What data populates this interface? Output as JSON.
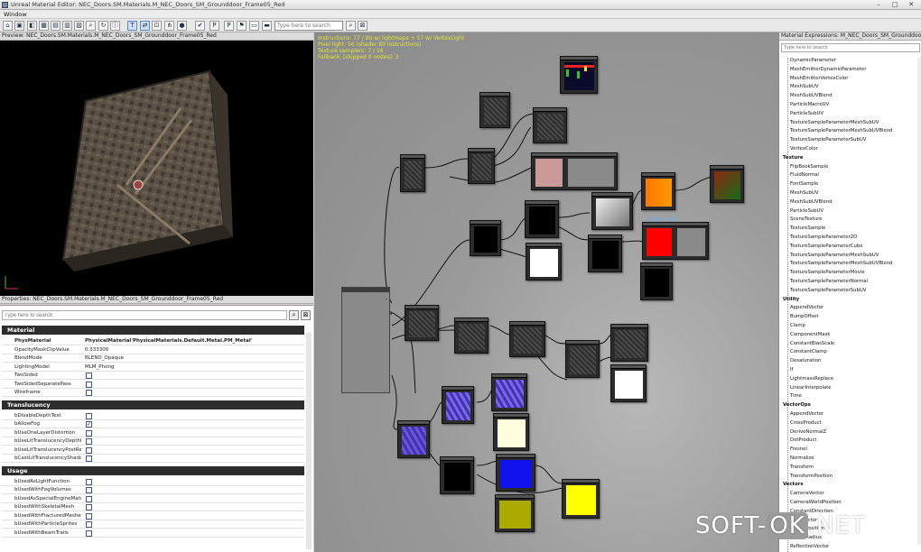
{
  "window": {
    "title": "Unreal Material Editor: NEC_Doors.SM.Materials.M_NEC_Doors_SM_Grounddoor_Frame05_Red",
    "menu": "Window"
  },
  "toolbar": {
    "search_placeholder": "Type here to search"
  },
  "preview": {
    "title": "Preview: NEC_Doors.SM.Materials.M_NEC_Doors_SM_Grounddoor_Frame05_Red"
  },
  "properties": {
    "title": "Properties: NEC_Doors.SM.Materials.M_NEC_Doors_SM_Grounddoor_Frame05_Red",
    "search_placeholder": "Type here to search",
    "sections": [
      {
        "name": "Material",
        "rows": [
          {
            "key": "PhysMaterial",
            "value": "PhysicalMaterial'PhysicalMaterials.Default.Metal.PM_Metal'",
            "bold": true
          },
          {
            "key": "OpacityMaskClipValue",
            "value": "0.333300"
          },
          {
            "key": "BlendMode",
            "value": "BLEND_Opaque"
          },
          {
            "key": "LightingModel",
            "value": "MLM_Phong"
          },
          {
            "key": "TwoSided",
            "checked": false
          },
          {
            "key": "TwoSidedSeparatePass",
            "checked": false
          },
          {
            "key": "Wireframe",
            "checked": false
          }
        ]
      },
      {
        "name": "Translucency",
        "rows": [
          {
            "key": "bDisableDepthTest",
            "checked": false
          },
          {
            "key": "bAllowFog",
            "checked": true
          },
          {
            "key": "bUseOneLayerDistortion",
            "checked": false
          },
          {
            "key": "bUseLitTranslucencyDepthPa",
            "checked": false
          },
          {
            "key": "bUseLitTranslucencyPostRen",
            "checked": false
          },
          {
            "key": "bCastLitTranslucencyShadow",
            "checked": false
          }
        ]
      },
      {
        "name": "Usage",
        "rows": [
          {
            "key": "bUsedAsLightFunction",
            "checked": false
          },
          {
            "key": "bUsedWithFogVolumes",
            "checked": false
          },
          {
            "key": "bUsedAsSpecialEngineMateri",
            "checked": false
          },
          {
            "key": "bUsedWithSkeletalMesh",
            "checked": false
          },
          {
            "key": "bUsedWithFracturedMeshes",
            "checked": false
          },
          {
            "key": "bUsedWithParticleSprites",
            "checked": false
          },
          {
            "key": "bUsedWithBeamTrails",
            "checked": false
          }
        ]
      }
    ]
  },
  "graph": {
    "stats": "Instructions: 77 / 80 w/ lightmaps + 57 w/ VertexLight\nPixel light: 56 (shader 80 instructions)\nTexture samplers: 7 / 16\nFallback: [skipped 0 nodes]: 3",
    "light_color_label": "Light Color"
  },
  "expressions": {
    "title": "Material Expressions: M_NEC_Doors_SM_Grounddoor_Frame05_Red",
    "search_placeholder": "Type here to search",
    "items": [
      {
        "label": "DynamicParameter"
      },
      {
        "label": "MeshEmitterDynamicParameter"
      },
      {
        "label": "MeshEmitterVertexColor"
      },
      {
        "label": "MeshSubUV"
      },
      {
        "label": "MeshSubUVBlend"
      },
      {
        "label": "ParticleMacroUV"
      },
      {
        "label": "ParticleSubUV"
      },
      {
        "label": "TextureSampleParameterMeshSubUV"
      },
      {
        "label": "TextureSampleParameterMeshSubUVBlend"
      },
      {
        "label": "TextureSampleParameterSubUV"
      },
      {
        "label": "VertexColor"
      },
      {
        "label": "Texture",
        "cat": true
      },
      {
        "label": "FlipBookSample"
      },
      {
        "label": "FluidNormal"
      },
      {
        "label": "FontSample"
      },
      {
        "label": "MeshSubUV"
      },
      {
        "label": "MeshSubUVBlend"
      },
      {
        "label": "ParticleSubUV"
      },
      {
        "label": "SceneTexture"
      },
      {
        "label": "TextureSample"
      },
      {
        "label": "TextureSampleParameter2D"
      },
      {
        "label": "TextureSampleParameterCube"
      },
      {
        "label": "TextureSampleParameterMeshSubUV"
      },
      {
        "label": "TextureSampleParameterMeshSubUVBlend"
      },
      {
        "label": "TextureSampleParameterMovie"
      },
      {
        "label": "TextureSampleParameterNormal"
      },
      {
        "label": "TextureSampleParameterSubUV"
      },
      {
        "label": "Utility",
        "cat": true
      },
      {
        "label": "AppendVector"
      },
      {
        "label": "BumpOffset"
      },
      {
        "label": "Clamp"
      },
      {
        "label": "ComponentMask"
      },
      {
        "label": "ConstantBiasScale"
      },
      {
        "label": "ConstantClamp"
      },
      {
        "label": "Desaturation"
      },
      {
        "label": "If"
      },
      {
        "label": "LightmassReplace"
      },
      {
        "label": "LinearInterpolate"
      },
      {
        "label": "Time"
      },
      {
        "label": "VectorOps",
        "cat": true
      },
      {
        "label": "AppendVector"
      },
      {
        "label": "CrossProduct"
      },
      {
        "label": "DeriveNormalZ"
      },
      {
        "label": "DotProduct"
      },
      {
        "label": "Fresnel"
      },
      {
        "label": "Normalize"
      },
      {
        "label": "Transform"
      },
      {
        "label": "TransformPosition"
      },
      {
        "label": "Vectors",
        "cat": true
      },
      {
        "label": "CameraVector"
      },
      {
        "label": "CameraWorldPosition"
      },
      {
        "label": "ConstantDirection"
      },
      {
        "label": "LightVector"
      },
      {
        "label": "ObjectPosition"
      },
      {
        "label": "ObjectRadius"
      },
      {
        "label": "ReflectionVector"
      }
    ]
  },
  "watermark": {
    "left": "SOFT-",
    "box": "OK",
    "right": ".NET"
  },
  "colors": {
    "graph_bg": "#9a9a9a",
    "section_bg": "#2d2d2d",
    "stats_text": "#e6e632"
  }
}
